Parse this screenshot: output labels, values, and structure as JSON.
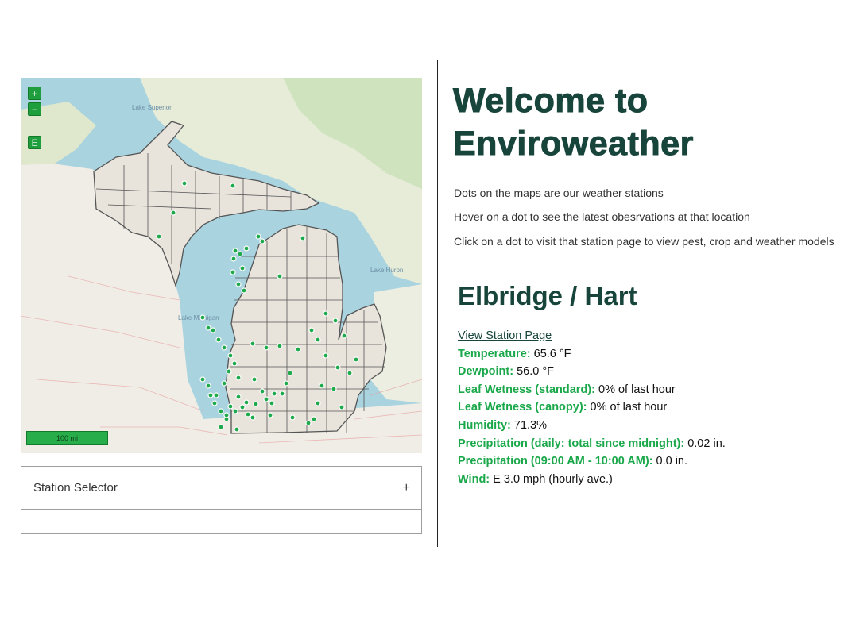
{
  "map": {
    "zoom_in_label": "+",
    "zoom_out_label": "−",
    "layers_label": "E",
    "scale_label": "100 mi",
    "water_labels": [
      "Lake Superior",
      "Lake Michigan",
      "Lake Huron"
    ],
    "colors": {
      "water": "#a9d3df",
      "land": "#f2efe9",
      "michigan": "#e8e4dc",
      "forest": "#cfe3bf",
      "county_border": "#4f4f4f",
      "station_dot": "#1ea94a"
    }
  },
  "station_selector": {
    "title": "Station Selector",
    "toggle": "+"
  },
  "welcome": {
    "title": "Welcome to Enviroweather",
    "intro": [
      "Dots on the maps are our weather stations",
      "Hover on a dot to see the latest obesrvations at that location",
      "Click on a dot to visit that station page to view pest, crop and weather models"
    ]
  },
  "station": {
    "name": "Elbridge / Hart",
    "link_label": "View Station Page",
    "observations": [
      {
        "label": "Temperature:",
        "value": "65.6 °F"
      },
      {
        "label": "Dewpoint:",
        "value": "56.0 °F"
      },
      {
        "label": "Leaf Wetness (standard):",
        "value": "0% of last hour"
      },
      {
        "label": "Leaf Wetness (canopy):",
        "value": "0% of last hour"
      },
      {
        "label": "Humidity:",
        "value": "71.3%"
      },
      {
        "label": "Precipitation (daily: total since midnight):",
        "value": "0.02 in."
      },
      {
        "label": "Precipitation (09:00 AM - 10:00 AM):",
        "value": "0.0 in."
      },
      {
        "label": "Wind:",
        "value": "E 3.0 mph (hourly ave.)"
      }
    ]
  }
}
